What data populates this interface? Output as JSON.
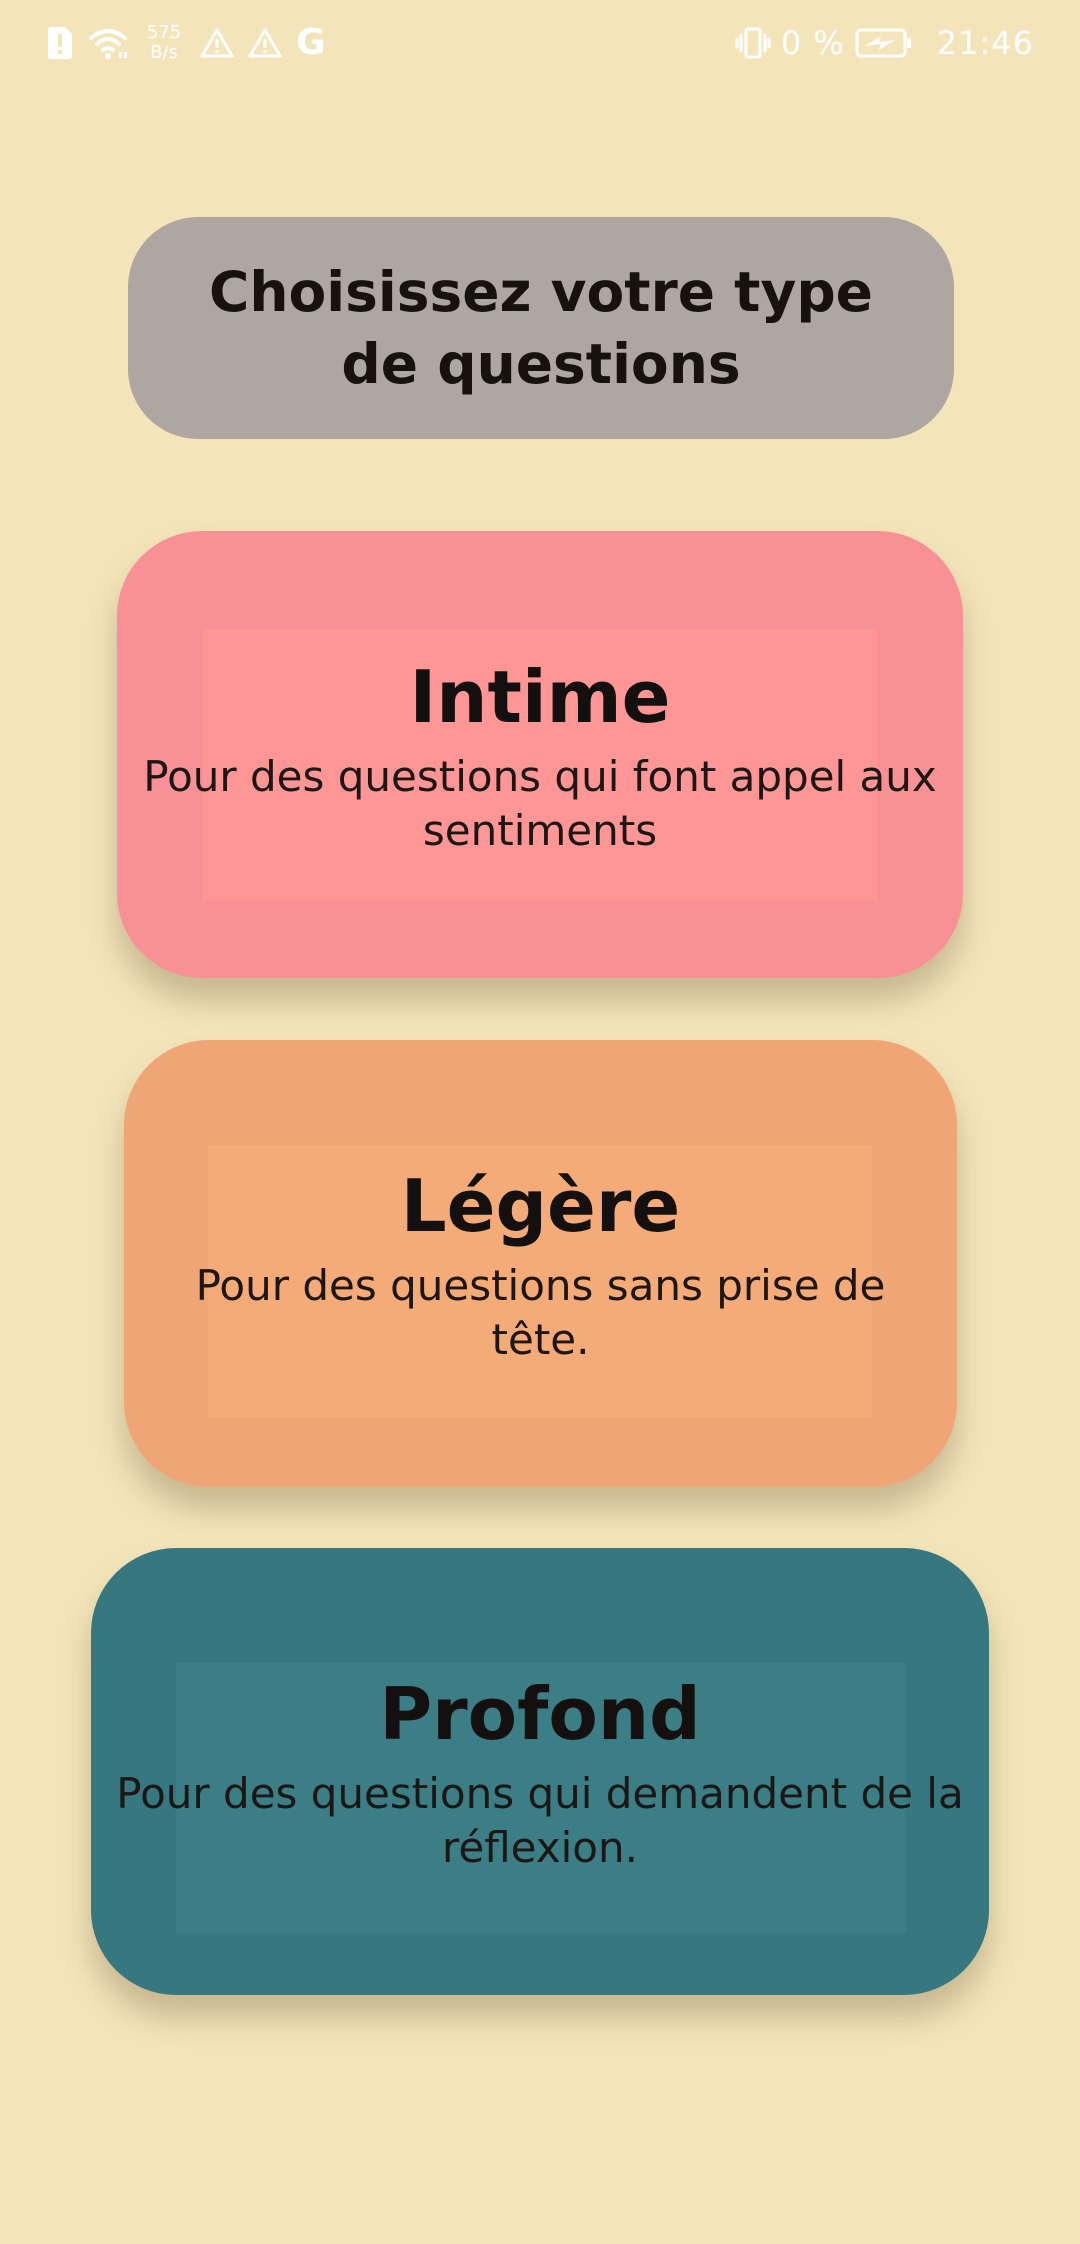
{
  "status_bar": {
    "net_speed_value": "575",
    "net_speed_unit": "B/s",
    "network_letter": "G",
    "battery_percent": "0 %",
    "time": "21:46"
  },
  "header": {
    "title": "Choisissez votre type de questions"
  },
  "choices": [
    {
      "title": "Intime",
      "description": "Pour des questions qui font appel aux sentiments",
      "color": "#f89196"
    },
    {
      "title": "Légère",
      "description": "Pour des questions sans prise de tête.",
      "color": "#efa576"
    },
    {
      "title": "Profond",
      "description": "Pour des questions qui demandent de la réflexion.",
      "color": "#377880"
    }
  ],
  "colors": {
    "background": "#f3e4b9",
    "title_card": "#aea6a0"
  }
}
